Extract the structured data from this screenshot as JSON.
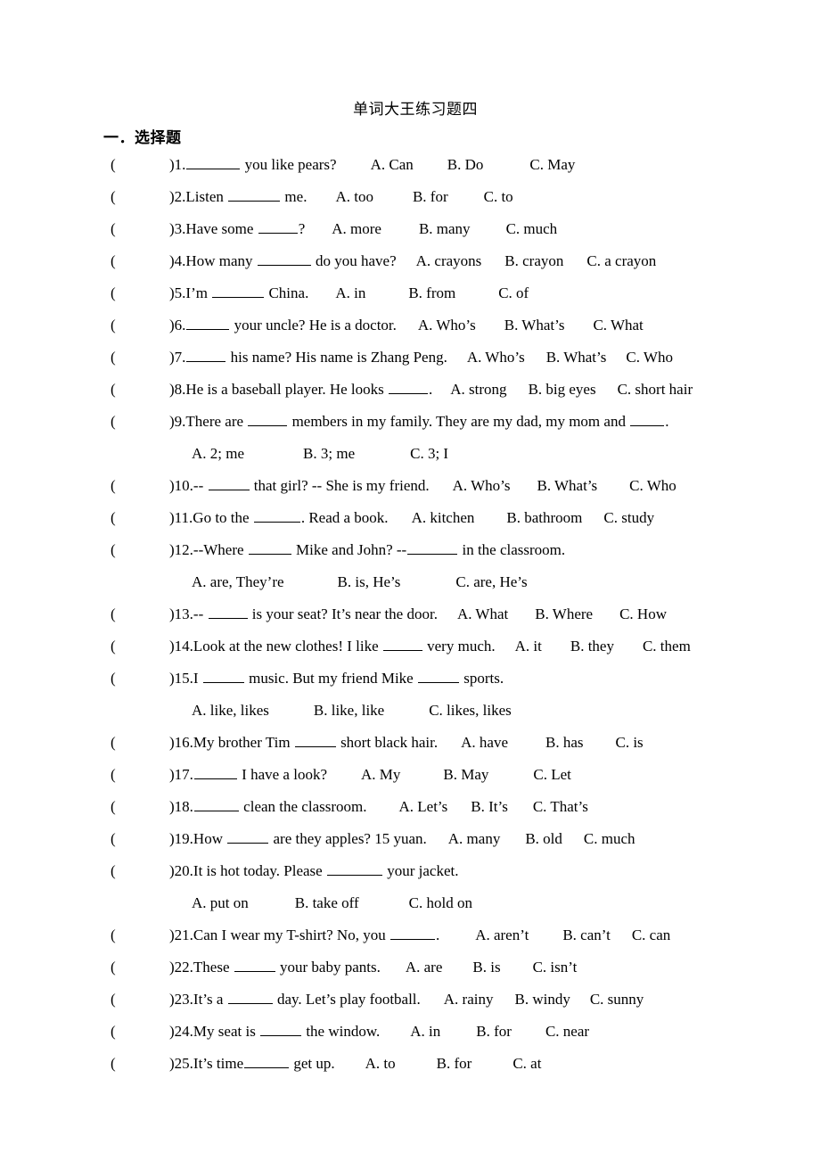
{
  "document": {
    "title": "单词大王练习题四",
    "section_heading": "一．选择题",
    "paren_open": "(",
    "paren_close": ")"
  },
  "questions": [
    {
      "number": "1.",
      "parts": [
        "",
        " you like pears?"
      ],
      "blank_widths": [
        60
      ],
      "options": [
        "A. Can",
        "B. Do",
        "C. May"
      ],
      "option_gaps": [
        38,
        38,
        52
      ],
      "continuation": null
    },
    {
      "number": "2.",
      "parts": [
        "Listen ",
        " me."
      ],
      "blank_widths": [
        58
      ],
      "options": [
        "A. too",
        "B. for",
        "C. to"
      ],
      "option_gaps": [
        32,
        44,
        40
      ],
      "continuation": null
    },
    {
      "number": "3.",
      "parts": [
        "Have some ",
        "?"
      ],
      "blank_widths": [
        44
      ],
      "options": [
        "A. more",
        "B. many",
        "C. much"
      ],
      "option_gaps": [
        30,
        42,
        40
      ],
      "continuation": null
    },
    {
      "number": "4.",
      "parts": [
        "How many ",
        " do you have?"
      ],
      "blank_widths": [
        60
      ],
      "options": [
        "A. crayons",
        "B. crayon",
        "C. a crayon"
      ],
      "option_gaps": [
        22,
        26,
        26
      ],
      "continuation": null
    },
    {
      "number": "5.",
      "parts": [
        "I’m ",
        " China."
      ],
      "blank_widths": [
        58
      ],
      "options": [
        "A. in",
        "B. from",
        "C. of"
      ],
      "option_gaps": [
        30,
        48,
        48
      ],
      "continuation": null
    },
    {
      "number": "6.",
      "parts": [
        "",
        " your uncle? He is a doctor."
      ],
      "blank_widths": [
        48
      ],
      "options": [
        "A. Who’s",
        "B. What’s",
        "C. What"
      ],
      "option_gaps": [
        24,
        32,
        32
      ],
      "continuation": null
    },
    {
      "number": "7.",
      "parts": [
        "",
        " his name? His name is Zhang Peng."
      ],
      "blank_widths": [
        44
      ],
      "options": [
        "A. Who’s",
        "B. What’s",
        "C. Who"
      ],
      "option_gaps": [
        22,
        24,
        22
      ],
      "continuation": null
    },
    {
      "number": "8.",
      "parts": [
        "He is a baseball player. He looks ",
        "."
      ],
      "blank_widths": [
        44
      ],
      "options": [
        "A. strong",
        "B. big eyes",
        "C. short hair"
      ],
      "option_gaps": [
        20,
        24,
        24
      ],
      "continuation": null
    },
    {
      "number": "9.",
      "parts": [
        "There are ",
        " members in my family. They are my dad, my mom and ",
        "."
      ],
      "blank_widths": [
        44,
        38
      ],
      "options": [],
      "option_gaps": [],
      "continuation": {
        "options": [
          "A. 2; me",
          "B. 3; me",
          "C. 3; I"
        ],
        "option_gaps": [
          0,
          66,
          62
        ]
      }
    },
    {
      "number": "10.",
      "parts": [
        "-- ",
        " that girl?   -- She is my friend."
      ],
      "blank_widths": [
        46
      ],
      "options": [
        "A. Who’s",
        "B. What’s",
        "C. Who"
      ],
      "option_gaps": [
        26,
        30,
        36
      ],
      "continuation": null
    },
    {
      "number": "11.",
      "parts": [
        "Go to the ",
        ". Read a book."
      ],
      "blank_widths": [
        52
      ],
      "options": [
        "A. kitchen",
        "B. bathroom",
        "C. study"
      ],
      "option_gaps": [
        26,
        36,
        24
      ],
      "continuation": null
    },
    {
      "number": "12.",
      "parts": [
        "--Where ",
        " Mike and John?   --",
        " in the classroom."
      ],
      "blank_widths": [
        48,
        56
      ],
      "options": [],
      "option_gaps": [],
      "continuation": {
        "options": [
          "A. are, They’re",
          "B. is, He’s",
          "C. are, He’s"
        ],
        "option_gaps": [
          0,
          60,
          62
        ]
      }
    },
    {
      "number": "13.",
      "parts": [
        "-- ",
        " is your seat? It’s near the door."
      ],
      "blank_widths": [
        44
      ],
      "options": [
        "A. What",
        "B. Where",
        "C. How"
      ],
      "option_gaps": [
        22,
        30,
        30
      ],
      "continuation": null
    },
    {
      "number": "14.",
      "parts": [
        "Look at the new clothes! I like ",
        " very much."
      ],
      "blank_widths": [
        44
      ],
      "options": [
        "A. it",
        "B. they",
        "C. them"
      ],
      "option_gaps": [
        22,
        32,
        32
      ],
      "continuation": null
    },
    {
      "number": "15.",
      "parts": [
        "I ",
        " music. But my friend Mike ",
        " sports."
      ],
      "blank_widths": [
        46,
        46
      ],
      "options": [],
      "option_gaps": [],
      "continuation": {
        "options": [
          "A. like, likes",
          "B. like, like",
          "C. likes, likes"
        ],
        "option_gaps": [
          0,
          50,
          50
        ]
      }
    },
    {
      "number": "16.",
      "parts": [
        "My brother Tim ",
        " short black hair."
      ],
      "blank_widths": [
        46
      ],
      "options": [
        "A. have",
        "B. has",
        "C. is"
      ],
      "option_gaps": [
        26,
        42,
        36
      ],
      "continuation": null
    },
    {
      "number": "17.",
      "parts": [
        "",
        " I have a look?"
      ],
      "blank_widths": [
        48
      ],
      "options": [
        "A. My",
        "B. May",
        "C. Let"
      ],
      "option_gaps": [
        38,
        48,
        50
      ],
      "continuation": null
    },
    {
      "number": "18.",
      "parts": [
        "",
        " clean the classroom."
      ],
      "blank_widths": [
        50
      ],
      "options": [
        "A. Let’s",
        "B. It’s",
        "C. That’s"
      ],
      "option_gaps": [
        36,
        26,
        28
      ],
      "continuation": null
    },
    {
      "number": "19.",
      "parts": [
        "How ",
        " are they apples?   15 yuan."
      ],
      "blank_widths": [
        46
      ],
      "options": [
        "A. many",
        "B. old",
        "C. much"
      ],
      "option_gaps": [
        24,
        28,
        24
      ],
      "continuation": null
    },
    {
      "number": "20.",
      "parts": [
        "It is hot today. Please ",
        " your jacket."
      ],
      "blank_widths": [
        62
      ],
      "options": [],
      "option_gaps": [],
      "continuation": {
        "options": [
          "A. put on",
          "B. take off",
          "C. hold on"
        ],
        "option_gaps": [
          0,
          52,
          56
        ]
      }
    },
    {
      "number": "21.",
      "parts": [
        "Can I wear my T-shirt?   No, you ",
        "."
      ],
      "blank_widths": [
        50
      ],
      "options": [
        "A. aren’t",
        "B. can’t",
        "C. can"
      ],
      "option_gaps": [
        40,
        38,
        24
      ],
      "continuation": null
    },
    {
      "number": "22.",
      "parts": [
        "These ",
        " your baby pants."
      ],
      "blank_widths": [
        46
      ],
      "options": [
        "A. are",
        "B. is",
        "C. isn’t"
      ],
      "option_gaps": [
        28,
        34,
        36
      ],
      "continuation": null
    },
    {
      "number": "23.",
      "parts": [
        "It’s a ",
        " day. Let’s play football."
      ],
      "blank_widths": [
        50
      ],
      "options": [
        "A. rainy",
        "B. windy",
        "C. sunny"
      ],
      "option_gaps": [
        26,
        24,
        22
      ],
      "continuation": null
    },
    {
      "number": "24.",
      "parts": [
        "My seat is ",
        " the window."
      ],
      "blank_widths": [
        46
      ],
      "options": [
        "A. in",
        "B. for",
        "C. near"
      ],
      "option_gaps": [
        34,
        40,
        38
      ],
      "continuation": null
    },
    {
      "number": "25.",
      "parts": [
        "It’s time",
        " get up."
      ],
      "blank_widths": [
        50
      ],
      "options": [
        "A. to",
        "B. for",
        "C. at"
      ],
      "option_gaps": [
        34,
        46,
        46
      ],
      "continuation": null
    }
  ]
}
